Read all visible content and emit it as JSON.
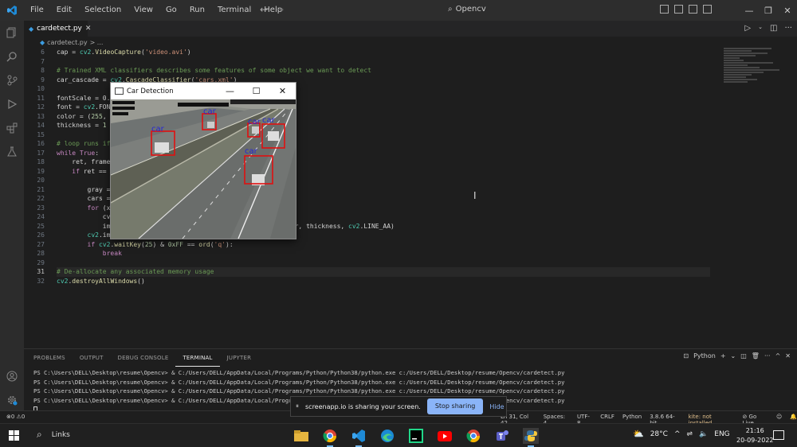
{
  "menu": [
    "File",
    "Edit",
    "Selection",
    "View",
    "Go",
    "Run",
    "Terminal",
    "Help"
  ],
  "command_center": "Opencv",
  "tab": {
    "label": "cardetect.py"
  },
  "breadcrumb": {
    "file": "cardetect.py",
    "sep": "> ..."
  },
  "editor": {
    "lines": [
      {
        "n": "6",
        "text": "cap = cv2.VideoCapture('video.avi')",
        "cls": ""
      },
      {
        "n": "7",
        "text": "",
        "cls": ""
      },
      {
        "n": "8",
        "text": "# Trained XML classifiers describes some features of some object we want to detect",
        "cls": "c-com"
      },
      {
        "n": "9",
        "text": "car_cascade = cv2.CascadeClassifier('cars.xml')",
        "cls": ""
      },
      {
        "n": "10",
        "text": "",
        "cls": ""
      },
      {
        "n": "11",
        "text": "fontScale = 0.",
        "cls": ""
      },
      {
        "n": "12",
        "text": "font = cv2.FON",
        "cls": ""
      },
      {
        "n": "13",
        "text": "color = (255, ",
        "cls": ""
      },
      {
        "n": "14",
        "text": "thickness = 1",
        "cls": ""
      },
      {
        "n": "15",
        "text": "",
        "cls": ""
      },
      {
        "n": "16",
        "text": "# loop runs if",
        "cls": "c-com"
      },
      {
        "n": "17",
        "text": "while True:",
        "cls": ""
      },
      {
        "n": "18",
        "text": "    ret, frame",
        "cls": ""
      },
      {
        "n": "19",
        "text": "    if ret ==",
        "cls": ""
      },
      {
        "n": "20",
        "text": "",
        "cls": ""
      },
      {
        "n": "21",
        "text": "        gray =",
        "cls": ""
      },
      {
        "n": "22",
        "text": "        cars =",
        "cls": ""
      },
      {
        "n": "23",
        "text": "        for (x",
        "cls": ""
      },
      {
        "n": "24",
        "text": "            cv",
        "cls": ""
      },
      {
        "n": "25",
        "text": "            im                                     Scale, color, thickness, cv2.LINE_AA)",
        "cls": ""
      },
      {
        "n": "26",
        "text": "        cv2.im",
        "cls": ""
      },
      {
        "n": "27",
        "text": "        if cv2.waitKey(25) & 0xFF == ord('q'):",
        "cls": ""
      },
      {
        "n": "28",
        "text": "            break",
        "cls": "c-kw"
      },
      {
        "n": "29",
        "text": "",
        "cls": ""
      },
      {
        "n": "31",
        "text": "# De-allocate any associated memory usage",
        "cls": "c-com",
        "current": true
      },
      {
        "n": "32",
        "text": "cv2.destroyAllWindows()",
        "cls": ""
      }
    ]
  },
  "popup": {
    "title": "Car Detection",
    "minimize": "—",
    "maximize": "☐",
    "close": "✕",
    "label": "car"
  },
  "panel": {
    "tabs": [
      "PROBLEMS",
      "OUTPUT",
      "DEBUG CONSOLE",
      "TERMINAL",
      "JUPYTER"
    ],
    "active_tab": "TERMINAL",
    "shell": "Python"
  },
  "terminal": {
    "lines": [
      "PS C:\\Users\\DELL\\Desktop\\resume\\Opencv> & C:/Users/DELL/AppData/Local/Programs/Python/Python38/python.exe c:/Users/DELL/Desktop/resume/Opencv/cardetect.py",
      "PS C:\\Users\\DELL\\Desktop\\resume\\Opencv> & C:/Users/DELL/AppData/Local/Programs/Python/Python38/python.exe c:/Users/DELL/Desktop/resume/Opencv/cardetect.py",
      "PS C:\\Users\\DELL\\Desktop\\resume\\Opencv> & C:/Users/DELL/AppData/Local/Programs/Python/Python38/python.exe c:/Users/DELL/Desktop/resume/Opencv/cardetect.py",
      "PS C:\\Users\\DELL\\Desktop\\resume\\Opencv> & C:/Users/DELL/AppData/Local/Programs/Python/Python38/python.exe c:/Users/DELL/Desktop/resume/Opencv/cardetect.py"
    ]
  },
  "share": {
    "text": "screenapp.io is sharing your screen.",
    "stop": "Stop sharing",
    "hide": "Hide"
  },
  "status": {
    "problems": "⊗0 ⚠0",
    "position": "Ln 31, Col 42",
    "spaces": "Spaces: 4",
    "encoding": "UTF-8",
    "eol": "CRLF",
    "language": "Python",
    "interpreter": "3.8.6 64-bit",
    "warning": "kite: not installed",
    "golive": "⊘ Go Live"
  },
  "taskbar": {
    "search": "Links",
    "temp": "28°C",
    "lang": "ENG",
    "time": "21:16",
    "date": "20-09-2022"
  }
}
